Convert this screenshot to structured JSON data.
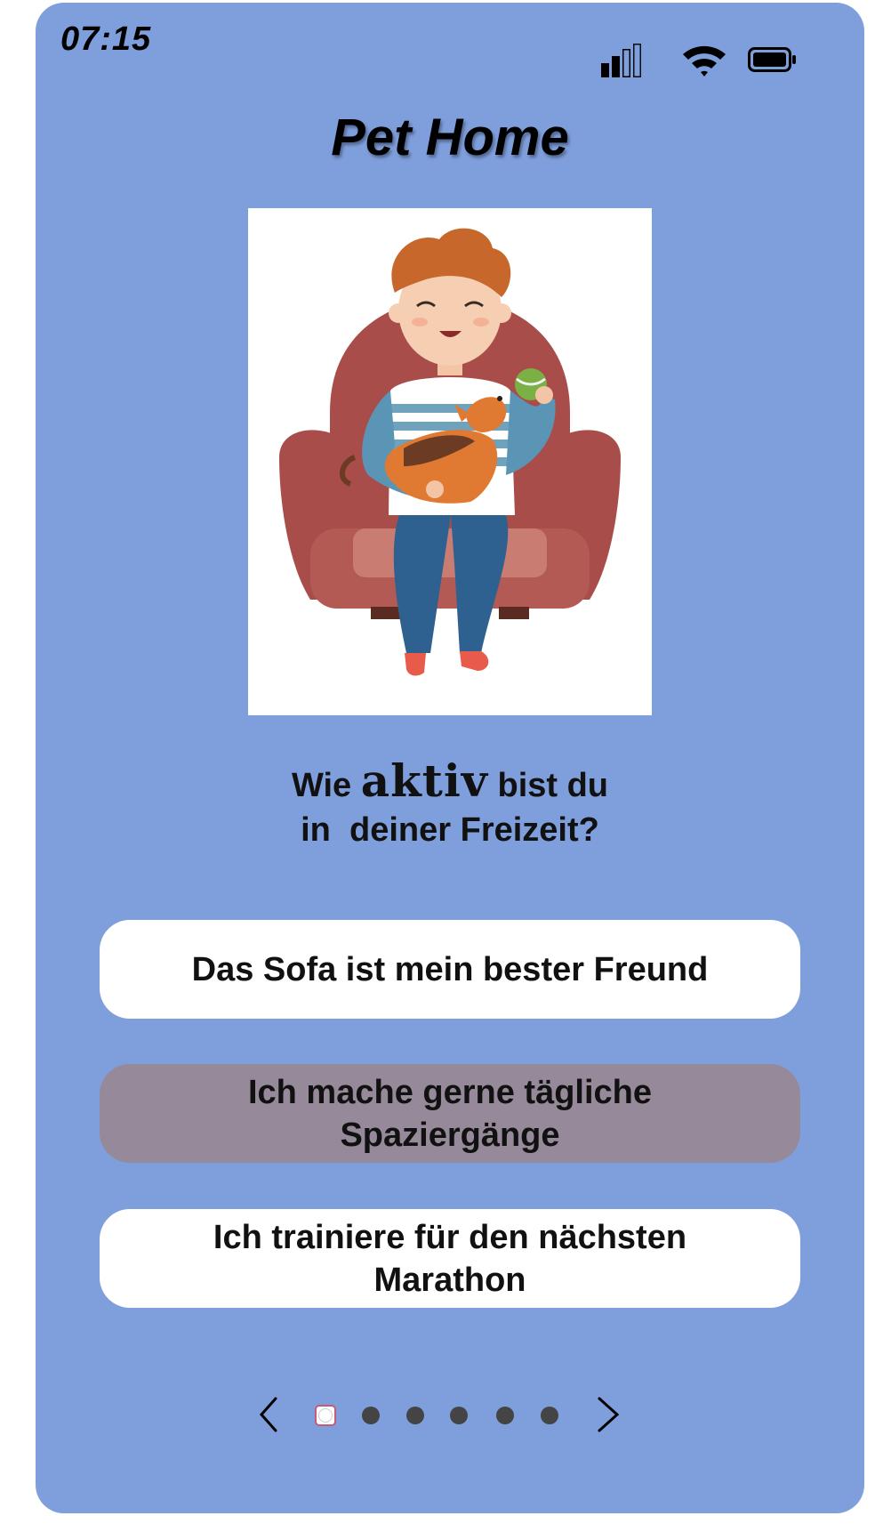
{
  "status_bar": {
    "time": "07:15",
    "signal_icon": "cellular-signal-icon",
    "wifi_icon": "wifi-icon",
    "battery_icon": "battery-icon"
  },
  "app": {
    "title": "Pet Home"
  },
  "hero": {
    "illustration": "person-on-armchair-with-dog-illustration"
  },
  "question": {
    "line1_before": "Wie ",
    "line1_accent": "aktiv",
    "line1_after": " bist du",
    "line2": "in  deiner Freizeit?"
  },
  "options": [
    {
      "label": "Das Sofa ist mein bester Freund",
      "selected": false
    },
    {
      "label": "Ich mache gerne tägliche Spaziergänge",
      "selected": true
    },
    {
      "label": "Ich trainiere für den nächsten Marathon",
      "selected": false
    }
  ],
  "pager": {
    "prev_icon": "chevron-left-icon",
    "next_icon": "chevron-right-icon",
    "total": 6,
    "current": 1
  },
  "colors": {
    "background": "#7f9edc",
    "card": "#ffffff",
    "selected_option": "#968a9a",
    "text": "#111111"
  }
}
